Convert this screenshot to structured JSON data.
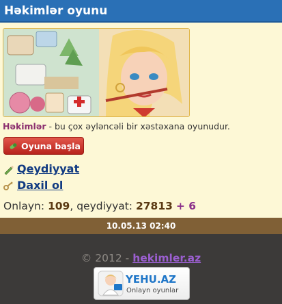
{
  "header": {
    "title": "Həkimlər oyunu"
  },
  "banner": {
    "image": "game-banner-doctor-girl"
  },
  "intro": {
    "brand": "Həkimlər",
    "text": " - bu çox əyləncəli bir xəstəxana oyunudur."
  },
  "play_button": {
    "label": "Oyuna başla",
    "icon": "pill-icon"
  },
  "links": [
    {
      "label": "Qeydiyyat",
      "icon": "pencil-icon"
    },
    {
      "label": "Daxil ol",
      "icon": "key-icon"
    }
  ],
  "stats": {
    "online_label": "Onlayn: ",
    "online": "109",
    "registered_label": ", qeydiyyat: ",
    "registered": "27813",
    "new": "+ 6"
  },
  "time": "10.05.13 02:40",
  "footer": {
    "copyright": "© 2012 - ",
    "site": "hekimler.az"
  },
  "partner": {
    "name": "YEHU.AZ",
    "subtitle": "Onlayn oyunlar"
  },
  "colors": {
    "header": "#2a70b6",
    "brand": "#8b2f6e",
    "link": "#123b82",
    "button": "#c63026",
    "timebar": "#806036",
    "footer": "#3c3a39"
  }
}
